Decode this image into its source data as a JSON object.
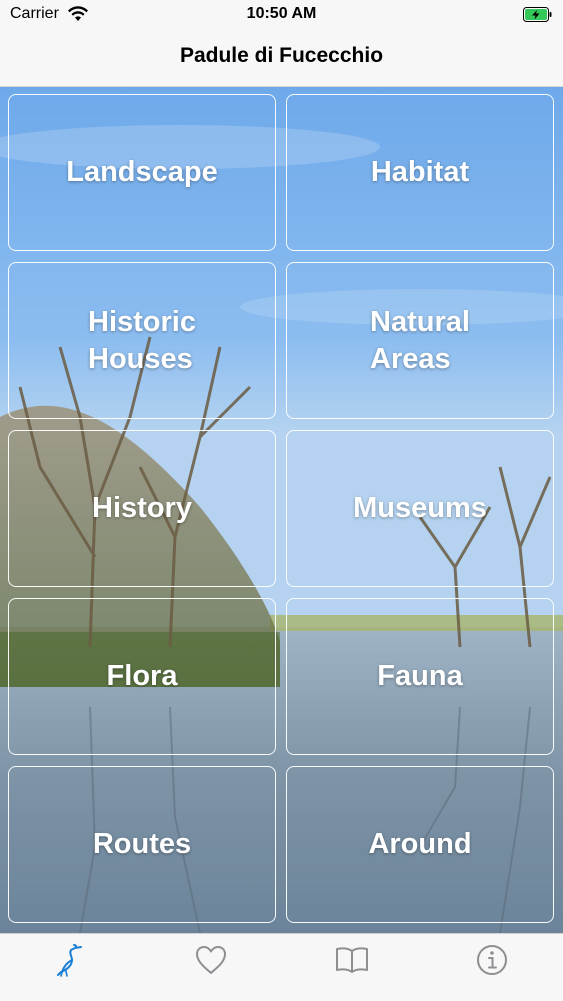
{
  "status_bar": {
    "carrier": "Carrier",
    "time": "10:50 AM"
  },
  "nav": {
    "title": "Padule di Fucecchio"
  },
  "tiles": [
    {
      "label": "Landscape"
    },
    {
      "label": "Habitat"
    },
    {
      "label": "Historic\nHouses"
    },
    {
      "label": "Natural\nAreas"
    },
    {
      "label": "History"
    },
    {
      "label": "Museums"
    },
    {
      "label": "Flora"
    },
    {
      "label": "Fauna"
    },
    {
      "label": "Routes"
    },
    {
      "label": "Around"
    }
  ],
  "tab_bar": {
    "items": [
      {
        "icon": "heron-icon",
        "selected": true
      },
      {
        "icon": "heart-icon",
        "selected": false
      },
      {
        "icon": "book-icon",
        "selected": false
      },
      {
        "icon": "info-icon",
        "selected": false
      }
    ]
  },
  "colors": {
    "accent": "#1a7fd4",
    "inactive_icon": "#8e8e93",
    "sky_top": "#6fa8e8",
    "water": "#7c94a8"
  }
}
